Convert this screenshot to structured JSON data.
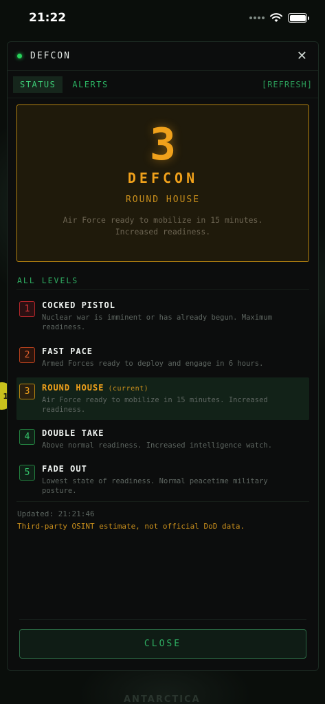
{
  "status_bar": {
    "time": "21:22"
  },
  "bg": {
    "badge_text": "1",
    "label": "ANTARCTICA"
  },
  "panel": {
    "title": "DEFCON",
    "tabs": [
      {
        "label": "STATUS",
        "active": true
      },
      {
        "label": "ALERTS",
        "active": false
      }
    ],
    "refresh_label": "[REFRESH]",
    "hero": {
      "number": "3",
      "word": "DEFCON",
      "name": "ROUND HOUSE",
      "description": "Air Force ready to mobilize in 15 minutes. Increased readiness."
    },
    "levels_title": "ALL LEVELS",
    "levels": [
      {
        "num": "1",
        "name": "COCKED PISTOL",
        "desc": "Nuclear war is imminent or has already begun. Maximum readiness.",
        "current": ""
      },
      {
        "num": "2",
        "name": "FAST PACE",
        "desc": "Armed Forces ready to deploy and engage in 6 hours.",
        "current": ""
      },
      {
        "num": "3",
        "name": "ROUND HOUSE",
        "desc": "Air Force ready to mobilize in 15 minutes. Increased readiness.",
        "current": "(current)"
      },
      {
        "num": "4",
        "name": "DOUBLE TAKE",
        "desc": "Above normal readiness. Increased intelligence watch.",
        "current": ""
      },
      {
        "num": "5",
        "name": "FADE OUT",
        "desc": "Lowest state of readiness. Normal peacetime military posture.",
        "current": ""
      }
    ],
    "updated": "Updated: 21:21:46",
    "disclaimer": "Third-party OSINT estimate, not official DoD data.",
    "close_label": "CLOSE"
  },
  "colors": {
    "accent_green": "#2fae62",
    "defcon_amber": "#f0a11b",
    "level1_red": "#e3393c",
    "level2_orange": "#e2612f"
  }
}
